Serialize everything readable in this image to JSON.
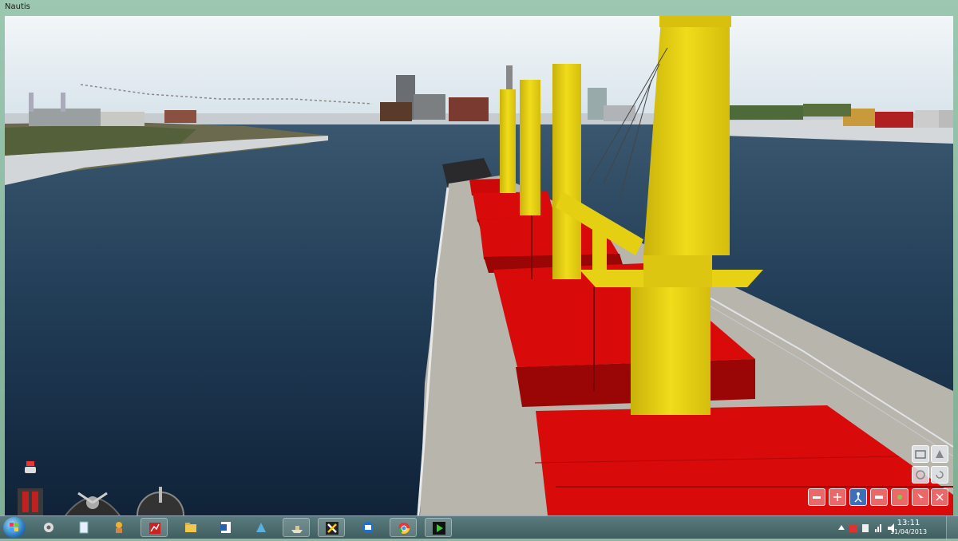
{
  "window": {
    "title": "Nautis"
  },
  "taskbar": {
    "items": [
      {
        "icon": "gear-icon"
      },
      {
        "icon": "notepad-icon"
      },
      {
        "icon": "character-icon"
      },
      {
        "icon": "chart-app-icon"
      },
      {
        "icon": "folder-icon"
      },
      {
        "icon": "word-icon"
      },
      {
        "icon": "paint-icon"
      },
      {
        "icon": "ship-icon"
      },
      {
        "icon": "xsplit-icon"
      },
      {
        "icon": "mail-icon"
      },
      {
        "icon": "chrome-icon"
      },
      {
        "icon": "play-icon"
      }
    ],
    "clock": {
      "time": "13:11",
      "date": "11/04/2013"
    }
  },
  "sim_toolbar": {
    "top_row": [
      {
        "icon": "camera-fixed-icon"
      },
      {
        "icon": "camera-free-icon"
      }
    ],
    "middle_row": [
      {
        "icon": "camera-orbit-icon"
      },
      {
        "icon": "rotate-icon"
      }
    ],
    "bottom_row": [
      {
        "icon": "tug-icon"
      },
      {
        "icon": "anchor-icon"
      },
      {
        "icon": "person-view-icon",
        "active": true
      },
      {
        "icon": "ship-view-icon"
      },
      {
        "icon": "marker-icon"
      },
      {
        "icon": "pointer-icon"
      },
      {
        "icon": "close-icon"
      }
    ]
  },
  "colors": {
    "sky": "#dfe9ef",
    "water": "#1a3048",
    "deck": "#b9b6ad",
    "hatch_red": "#d80a0a",
    "crane_yellow": "#ecd614",
    "active_tool": "#3c6fb8"
  }
}
